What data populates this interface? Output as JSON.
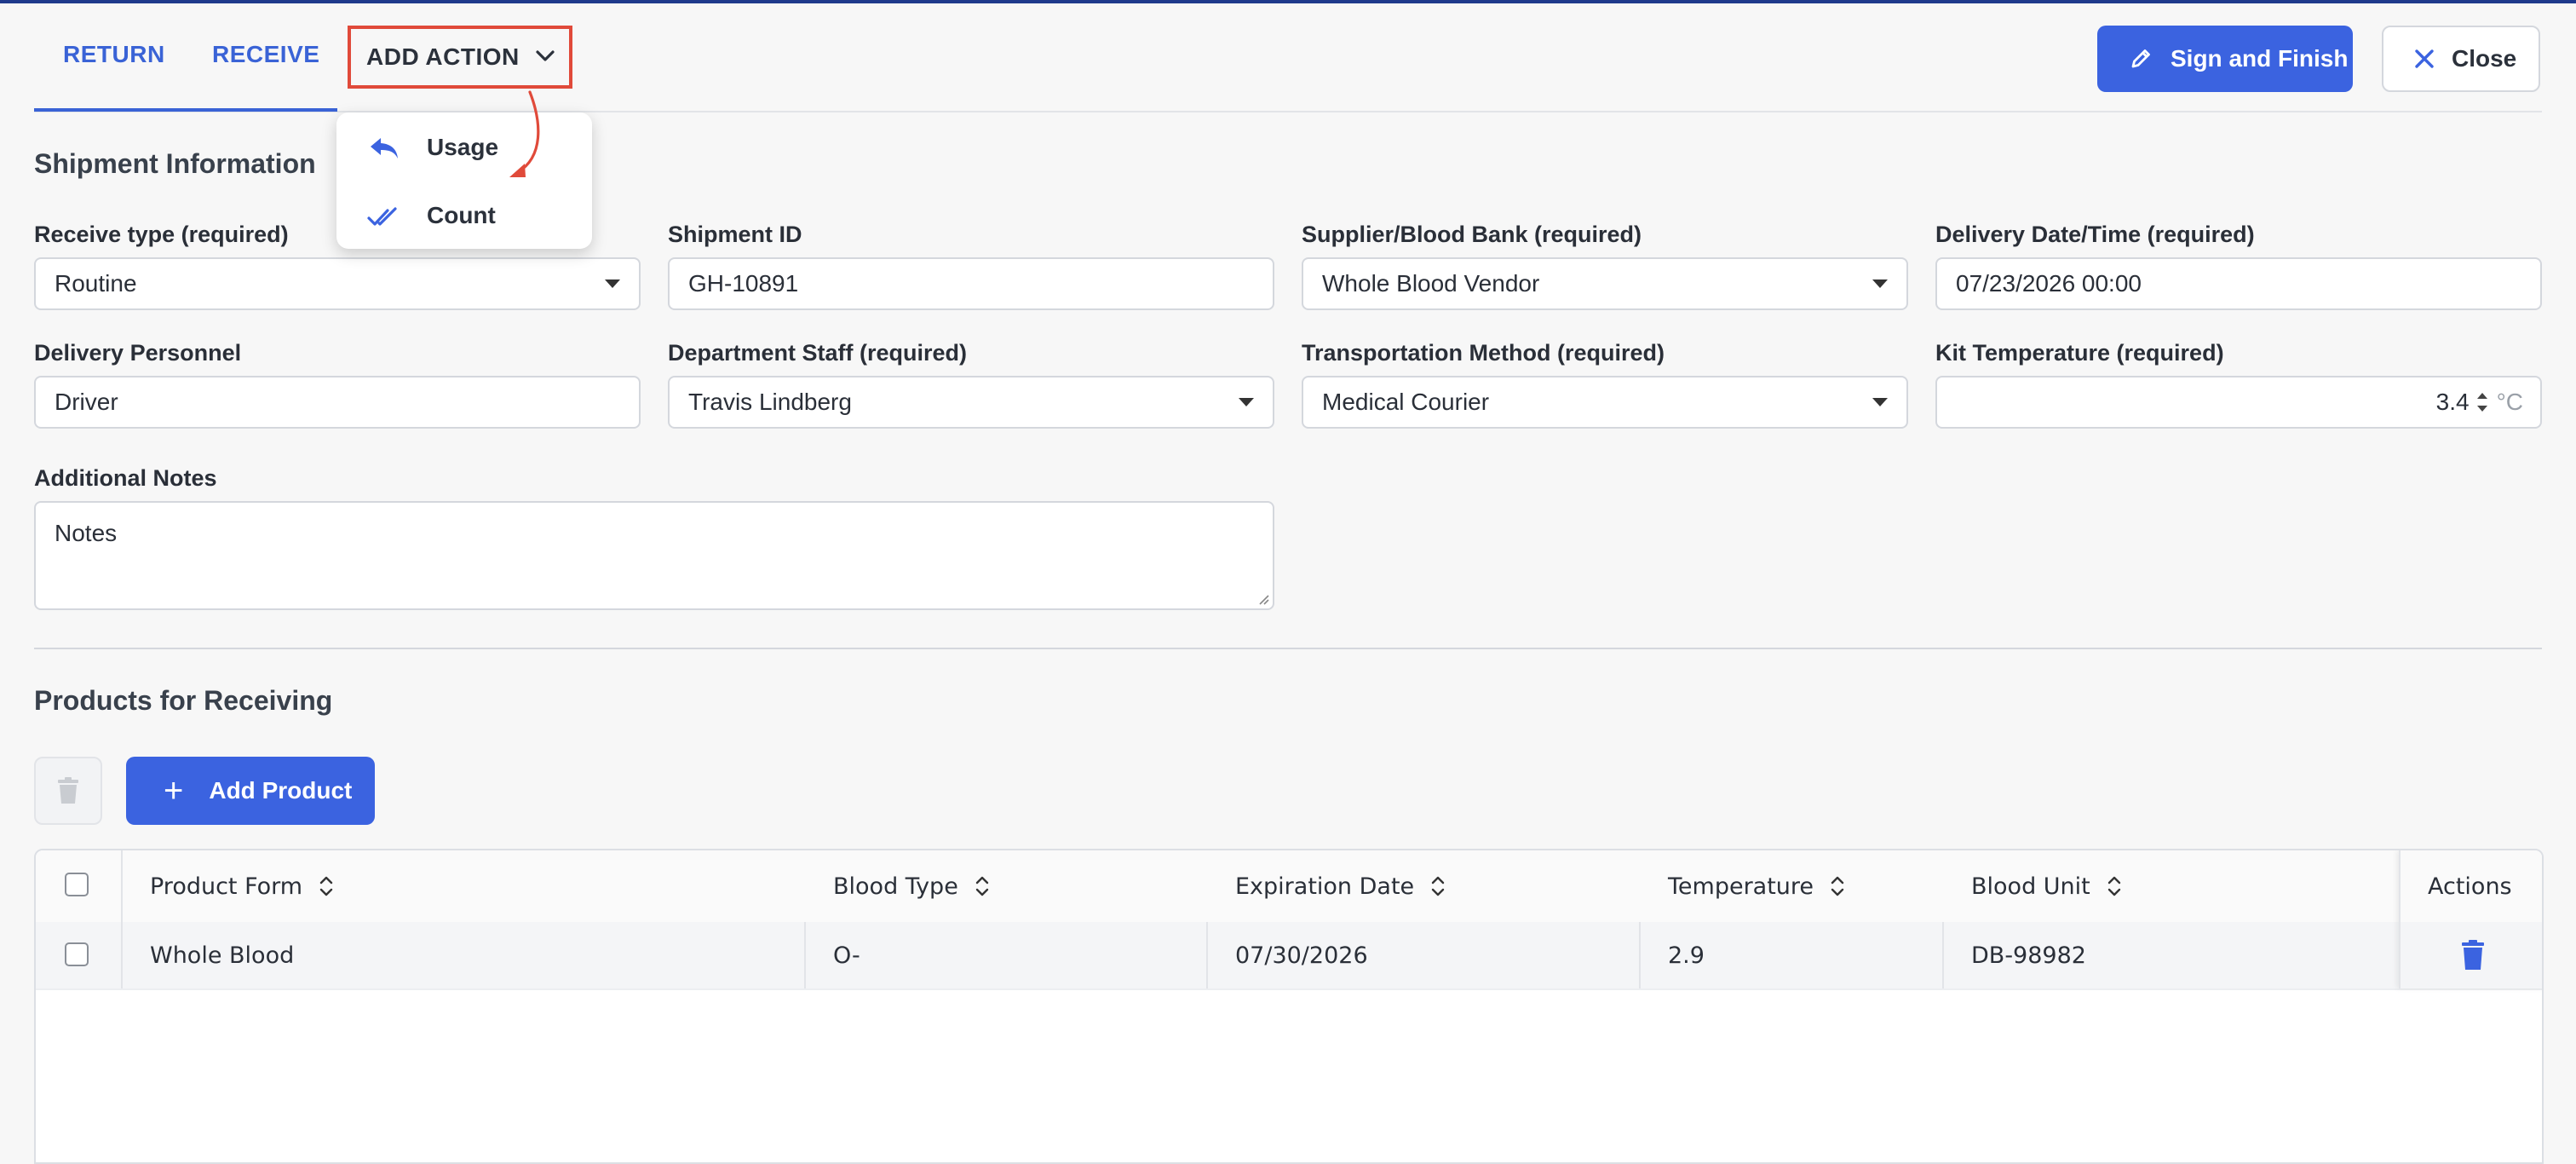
{
  "header": {
    "tabs": [
      "RETURN",
      "RECEIVE"
    ],
    "add_action_label": "ADD ACTION",
    "sign_finish_label": "Sign and Finish",
    "close_label": "Close"
  },
  "add_action_menu": {
    "items": [
      {
        "label": "Usage",
        "icon": "reply-arrow-icon"
      },
      {
        "label": "Count",
        "icon": "double-check-icon"
      }
    ]
  },
  "shipment": {
    "section_title": "Shipment Information",
    "receive_type": {
      "label": "Receive type (required)",
      "value": "Routine"
    },
    "shipment_id": {
      "label": "Shipment ID",
      "value": "GH-10891"
    },
    "supplier": {
      "label": "Supplier/Blood Bank (required)",
      "value": "Whole Blood Vendor"
    },
    "delivery_datetime": {
      "label": "Delivery Date/Time (required)",
      "value": "07/23/2026 00:00"
    },
    "delivery_personnel": {
      "label": "Delivery Personnel",
      "value": "Driver"
    },
    "department_staff": {
      "label": "Department Staff (required)",
      "value": "Travis Lindberg"
    },
    "transport_method": {
      "label": "Transportation Method (required)",
      "value": "Medical Courier"
    },
    "kit_temperature": {
      "label": "Kit Temperature (required)",
      "value": "3.4",
      "unit": "°C"
    },
    "notes": {
      "label": "Additional Notes",
      "value": "Notes"
    }
  },
  "products": {
    "section_title": "Products for Receiving",
    "add_product_label": "Add Product",
    "columns": [
      "Product Form",
      "Blood Type",
      "Expiration Date",
      "Temperature",
      "Blood Unit",
      "Actions"
    ],
    "rows": [
      {
        "product_form": "Whole Blood",
        "blood_type": "O-",
        "expiration_date": "07/30/2026",
        "temperature": "2.9",
        "blood_unit": "DB-98982"
      }
    ]
  },
  "colors": {
    "accent": "#3b63e0",
    "highlight_border": "#e04a3a"
  }
}
